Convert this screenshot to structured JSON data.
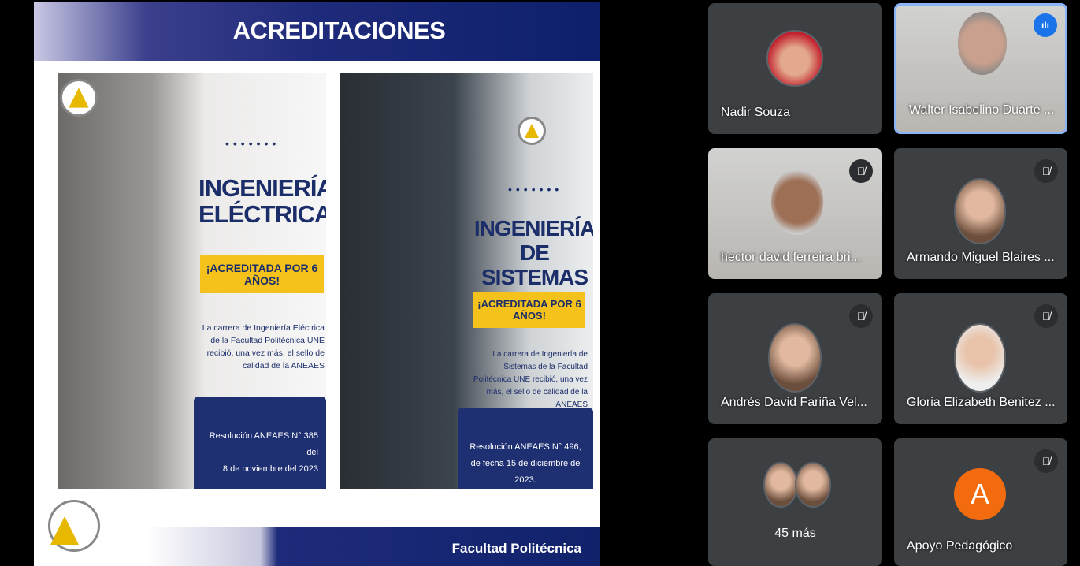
{
  "slide": {
    "title": "ACREDITACIONES",
    "panels": [
      {
        "dots": "•••••••",
        "title_line1": "INGENIERÍA",
        "title_line2": "ELÉCTRICA",
        "badge": "¡ACREDITADA POR 6 AÑOS!",
        "description": "La carrera de Ingeniería Eléctrica de la Facultad Politécnica UNE recibió, una vez más, el sello de calidad de la ANEAES",
        "resolution_line1": "Resolución ANEAES N° 385 del",
        "resolution_line2": "8 de noviembre del 2023"
      },
      {
        "dots": "•••••••",
        "title_line1": "INGENIERÍA",
        "title_line2": "DE SISTEMAS",
        "badge": "¡ACREDITADA POR 6 AÑOS!",
        "description": "La carrera de Ingeniería de Sistemas de la Facultad Politécnica UNE recibió, una vez más, el sello de calidad de la ANEAES",
        "resolution_line1": "Resolución ANEAES N° 496,",
        "resolution_line2": "de fecha 15 de diciembre de 2023."
      }
    ],
    "footer": "Facultad Politécnica"
  },
  "participants": [
    {
      "name": "Nadir Souza"
    },
    {
      "name": "Walter Isabelino Duarte ...",
      "speaking": true
    },
    {
      "name": "hector david ferreira bri...",
      "muted": true
    },
    {
      "name": "Armando Miguel Blaires ...",
      "muted": true
    },
    {
      "name": "Andrés David Fariña Vel...",
      "muted": true
    },
    {
      "name": "Gloria Elizabeth Benitez ...",
      "muted": true
    },
    {
      "name": "45 más"
    },
    {
      "name": "Apoyo Pedagógico",
      "initial": "A",
      "muted": true
    }
  ],
  "colors": {
    "accent": "#8ab4f8",
    "speaking": "#1a73e8",
    "tile": "#3c4043",
    "avatar_orange": "#f26b0f"
  }
}
